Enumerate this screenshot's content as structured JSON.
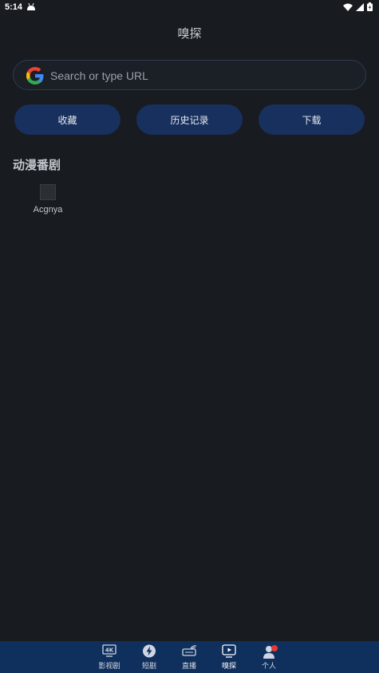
{
  "status_bar": {
    "time": "5:14"
  },
  "header": {
    "title": "嗅探"
  },
  "search": {
    "placeholder": "Search or type URL"
  },
  "actions": [
    {
      "label": "收藏"
    },
    {
      "label": "历史记录"
    },
    {
      "label": "下载"
    }
  ],
  "section": {
    "title": "动漫番剧",
    "sites": [
      {
        "label": "Acgnya"
      }
    ]
  },
  "bottom_nav": {
    "items": [
      {
        "label": "影视剧",
        "icon": "4k-tv-icon"
      },
      {
        "label": "短剧",
        "icon": "lightning-icon"
      },
      {
        "label": "直播",
        "icon": "live-satellite-icon"
      },
      {
        "label": "嗅探",
        "icon": "play-screen-icon"
      },
      {
        "label": "个人",
        "icon": "person-icon"
      }
    ],
    "active": "嗅探"
  },
  "colors": {
    "background": "#181b20",
    "button": "#18305e",
    "nav_background": "#0f2f5c",
    "badge": "#e53935"
  }
}
